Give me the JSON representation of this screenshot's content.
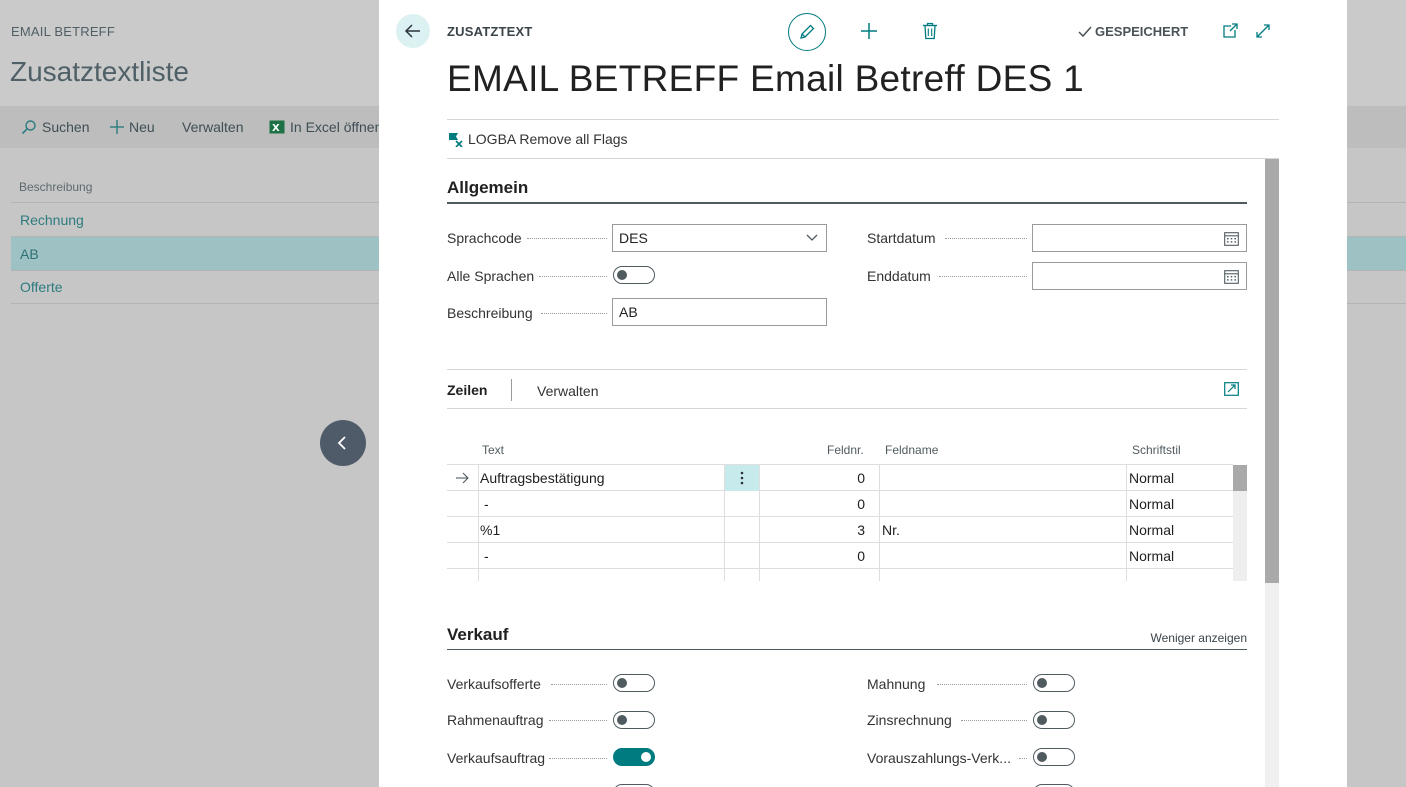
{
  "background": {
    "context": "EMAIL BETREFF",
    "title": "Zusatztextliste",
    "actions": {
      "search": "Suchen",
      "new": "Neu",
      "manage": "Verwalten",
      "excel": "In Excel öffnen"
    },
    "column_header": "Beschreibung",
    "rows": [
      "Rechnung",
      "AB",
      "Offerte"
    ],
    "selected_row": "AB"
  },
  "dialog": {
    "caption": "ZUSATZTEXT",
    "saved_label": "GESPEICHERT",
    "title": "EMAIL BETREFF Email Betreff DES 1",
    "promo_action": "LOGBA Remove all Flags",
    "general": {
      "title": "Allgemein",
      "language_code_label": "Sprachcode",
      "language_code_value": "DES",
      "all_languages_label": "Alle Sprachen",
      "all_languages_on": false,
      "description_label": "Beschreibung",
      "description_value": "AB",
      "start_date_label": "Startdatum",
      "start_date_value": "",
      "end_date_label": "Enddatum",
      "end_date_value": ""
    },
    "lines": {
      "tab_lines": "Zeilen",
      "tab_manage": "Verwalten",
      "columns": {
        "text": "Text",
        "field_no": "Feldnr.",
        "field_name": "Feldname",
        "style": "Schriftstil"
      },
      "rows": [
        {
          "text": "Auftragsbestätigung",
          "field_no": "0",
          "field_name": "",
          "style": "Normal"
        },
        {
          "text": "-",
          "field_no": "0",
          "field_name": "",
          "style": "Normal"
        },
        {
          "text": "%1",
          "field_no": "3",
          "field_name": "Nr.",
          "style": "Normal"
        },
        {
          "text": "-",
          "field_no": "0",
          "field_name": "",
          "style": "Normal"
        }
      ]
    },
    "sales": {
      "title": "Verkauf",
      "show_less": "Weniger anzeigen",
      "left": [
        {
          "label": "Verkaufsofferte",
          "on": false
        },
        {
          "label": "Rahmenauftrag",
          "on": false
        },
        {
          "label": "Verkaufsauftrag",
          "on": true
        }
      ],
      "right": [
        {
          "label": "Mahnung",
          "on": false
        },
        {
          "label": "Zinsrechnung",
          "on": false
        },
        {
          "label": "Vorauszahlungs-Verk...",
          "on": false
        }
      ]
    }
  },
  "colors": {
    "accent": "#007b7f",
    "selected_row": "#9ec1c3",
    "dots_menu": "#c7ebed"
  }
}
